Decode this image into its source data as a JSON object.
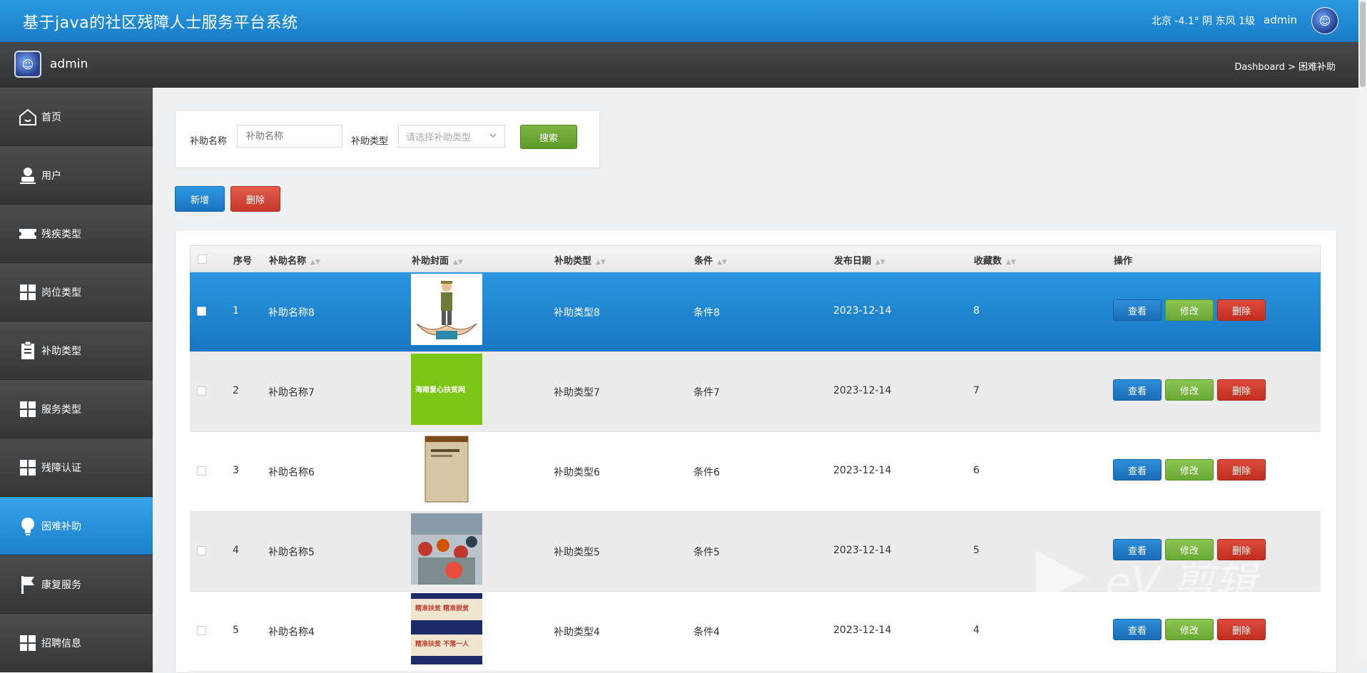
{
  "header": {
    "title": "基于java的社区残障人士服务平台系统",
    "weather": "北京  -4.1°  阴  东风  1级",
    "username": "admin"
  },
  "subheader": {
    "username": "admin",
    "breadcrumb": "Dashboard > 困难补助"
  },
  "sidebar": {
    "items": [
      {
        "label": "首页",
        "icon": "home-icon"
      },
      {
        "label": "用户",
        "icon": "user-icon"
      },
      {
        "label": "残疾类型",
        "icon": "ticket-icon"
      },
      {
        "label": "岗位类型",
        "icon": "grid-icon"
      },
      {
        "label": "补助类型",
        "icon": "clipboard-icon"
      },
      {
        "label": "服务类型",
        "icon": "grid-icon"
      },
      {
        "label": "残障认证",
        "icon": "grid-icon"
      },
      {
        "label": "困难补助",
        "icon": "lightbulb-icon",
        "active": true
      },
      {
        "label": "康复服务",
        "icon": "flag-icon"
      },
      {
        "label": "招聘信息",
        "icon": "grid-icon"
      }
    ]
  },
  "search": {
    "name_label": "补助名称",
    "name_placeholder": "补助名称",
    "type_label": "补助类型",
    "type_placeholder": "请选择补助类型",
    "search_button": "搜索"
  },
  "actions": {
    "add": "新增",
    "delete": "删除"
  },
  "table": {
    "columns": [
      "序号",
      "补助名称",
      "补助封面",
      "补助类型",
      "条件",
      "发布日期",
      "收藏数",
      "操作"
    ],
    "row_actions": {
      "view": "查看",
      "edit": "修改",
      "delete": "删除"
    },
    "rows": [
      {
        "index": "1",
        "name": "补助名称8",
        "type": "补助类型8",
        "condition": "条件8",
        "date": "2023-12-14",
        "favorites": "8",
        "selected": true
      },
      {
        "index": "2",
        "name": "补助名称7",
        "type": "补助类型7",
        "condition": "条件7",
        "date": "2023-12-14",
        "favorites": "7"
      },
      {
        "index": "3",
        "name": "补助名称6",
        "type": "补助类型6",
        "condition": "条件6",
        "date": "2023-12-14",
        "favorites": "6"
      },
      {
        "index": "4",
        "name": "补助名称5",
        "type": "补助类型5",
        "condition": "条件5",
        "date": "2023-12-14",
        "favorites": "5"
      },
      {
        "index": "5",
        "name": "补助名称4",
        "type": "补助类型4",
        "condition": "条件4",
        "date": "2023-12-14",
        "favorites": "4"
      }
    ]
  },
  "thumb_texts": {
    "row2": "海南爱心扶贫网",
    "row5_top": "精准扶贫 精准脱贫",
    "row5_bottom": "精准扶贫 不落一人"
  },
  "watermark": "eV 剪辑",
  "colors": {
    "primary": "#1a7cc8",
    "success": "#6aa837",
    "danger": "#c83a2a",
    "sidebar": "#3a3d40"
  }
}
